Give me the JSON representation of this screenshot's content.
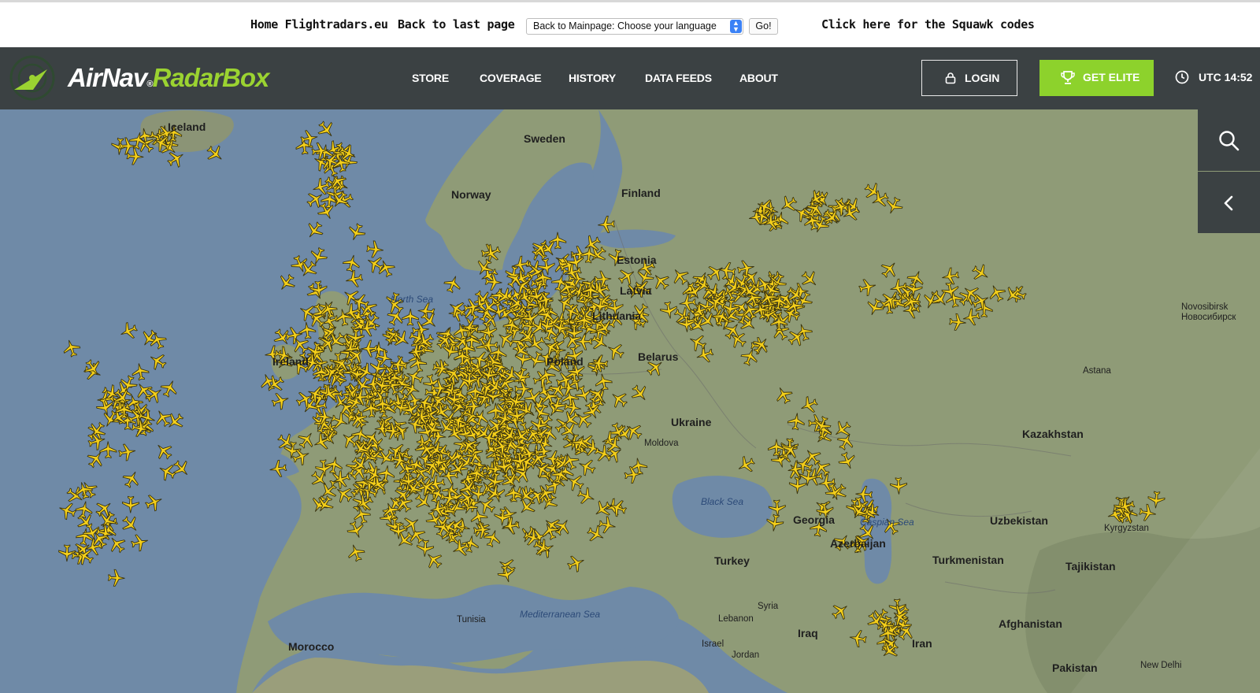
{
  "topbar": {
    "home_link": "Home Flightradars.eu",
    "back_link": "Back to last page",
    "language_select": "Back to Mainpage: Choose your language",
    "go_button": "Go!",
    "squawk_link": "Click here for the Squawk codes"
  },
  "header": {
    "logo_airnav": "AirNav",
    "logo_reg": "®",
    "logo_radarbox": "RadarBox",
    "nav": [
      "STORE",
      "COVERAGE",
      "HISTORY",
      "DATA FEEDS",
      "ABOUT"
    ],
    "login_label": "LOGIN",
    "elite_label": "GET ELITE",
    "utc_label": "UTC 14:52",
    "icons": {
      "login": "user-icon",
      "elite": "trophy-icon",
      "utc": "clock-icon"
    }
  },
  "map": {
    "countries": [
      "Iceland",
      "Sweden",
      "Norway",
      "Finland",
      "Estonia",
      "Latvia",
      "Lithuania",
      "Poland",
      "Belarus",
      "Ireland",
      "Ukraine",
      "Moldova",
      "Georgia",
      "Azerbaijan",
      "Turkey",
      "Syria",
      "Lebanon",
      "Israel",
      "Jordan",
      "Iraq",
      "Iran",
      "Tunisia",
      "Morocco",
      "Kazakhstan",
      "Uzbekistan",
      "Turkmenistan",
      "Kyrgyzstan",
      "Tajikistan",
      "Afghanistan",
      "Pakistan"
    ],
    "seas": [
      "North Sea",
      "Black Sea",
      "Caspian Sea",
      "Mediterranean Sea"
    ],
    "cities": {
      "novosibirsk_en": "Novosibirsk",
      "novosibirsk_ru": "Новосибирск",
      "astana": "Astana",
      "new_delhi": "New Delhi"
    },
    "aircraft_color": "#f4cf1a",
    "ocean_color": "#6f8aa7",
    "land_color": "#8f9b77"
  },
  "side_controls": {
    "search": "search-icon",
    "collapse": "chevron-left-icon"
  }
}
